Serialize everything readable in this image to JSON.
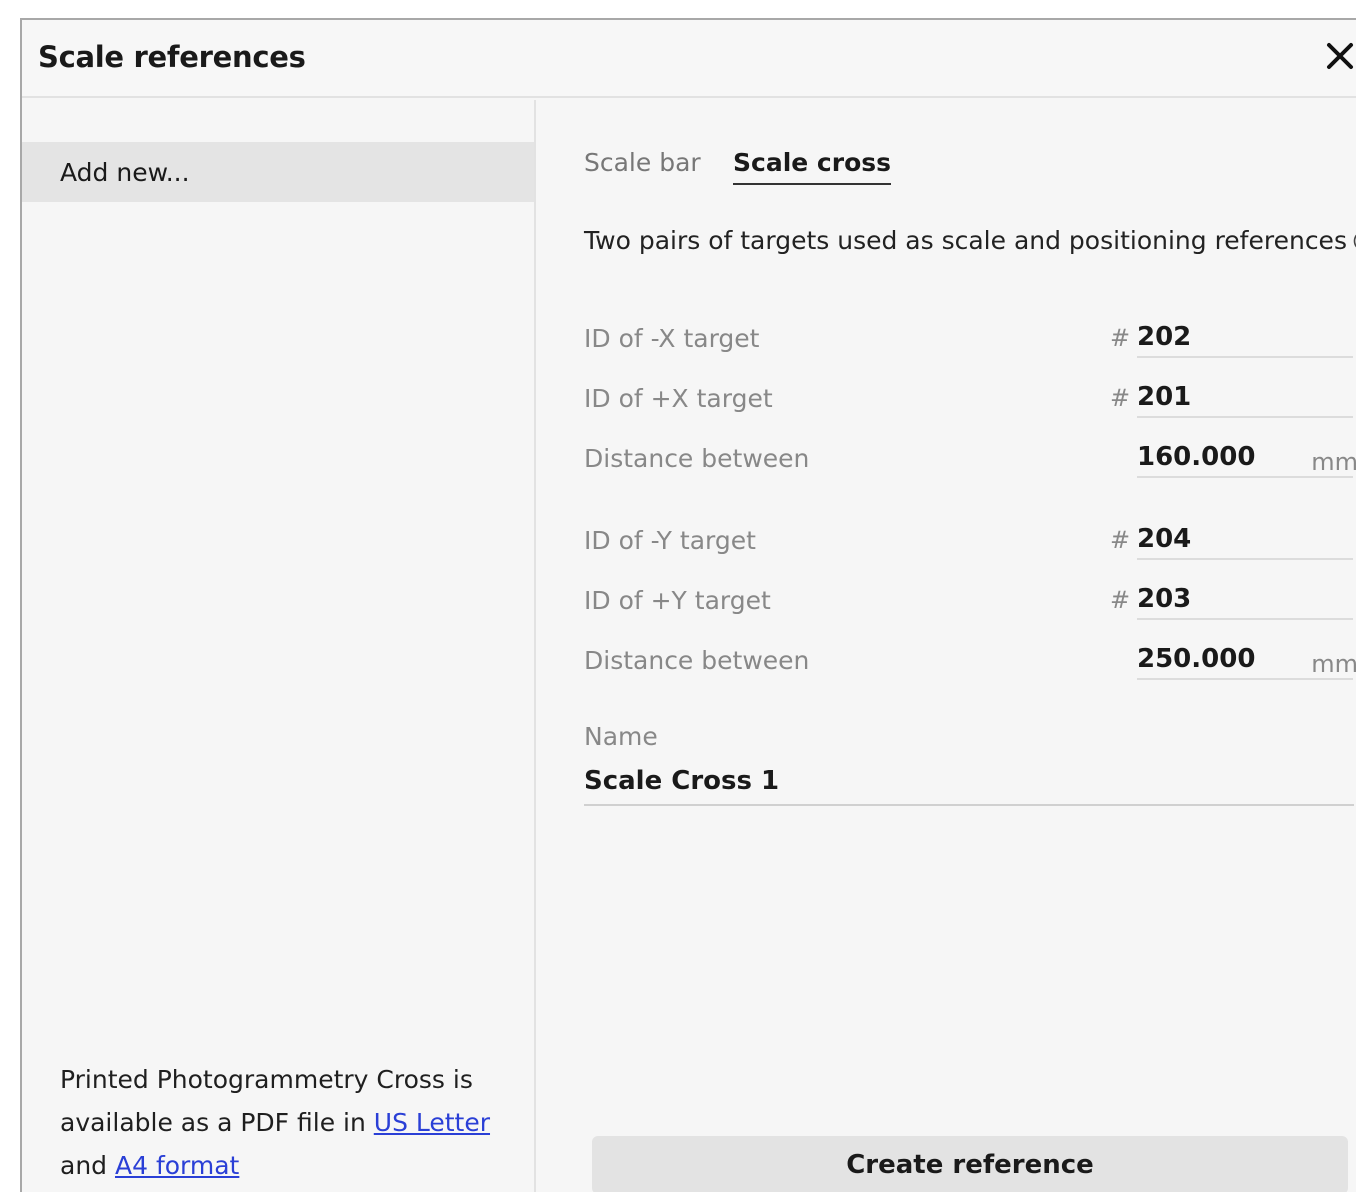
{
  "dialog": {
    "title": "Scale references",
    "close_icon": "close-icon"
  },
  "sidebar": {
    "add_new_label": "Add new...",
    "note": {
      "text_before": "Printed Photogrammetry Cross is available as a PDF file in ",
      "link1": "US Letter",
      "text_middle": " and ",
      "link2": "A4 format"
    }
  },
  "tabs": [
    {
      "label": "Scale bar",
      "active": false
    },
    {
      "label": "Scale cross",
      "active": true
    }
  ],
  "description": "Two pairs of targets used as scale and positioning references",
  "info_icon": "info-icon",
  "fields": [
    {
      "label": "ID of -X target",
      "prefix": "#",
      "value": "202",
      "unit": ""
    },
    {
      "label": "ID of +X target",
      "prefix": "#",
      "value": "201",
      "unit": ""
    },
    {
      "label": "Distance between",
      "prefix": "",
      "value": "160.000",
      "unit": "mm"
    },
    {
      "label": "ID of -Y target",
      "prefix": "#",
      "value": "204",
      "unit": ""
    },
    {
      "label": "ID of +Y target",
      "prefix": "#",
      "value": "203",
      "unit": ""
    },
    {
      "label": "Distance between",
      "prefix": "",
      "value": "250.000",
      "unit": "mm"
    }
  ],
  "name": {
    "label": "Name",
    "value": "Scale Cross 1"
  },
  "create_button_label": "Create reference"
}
